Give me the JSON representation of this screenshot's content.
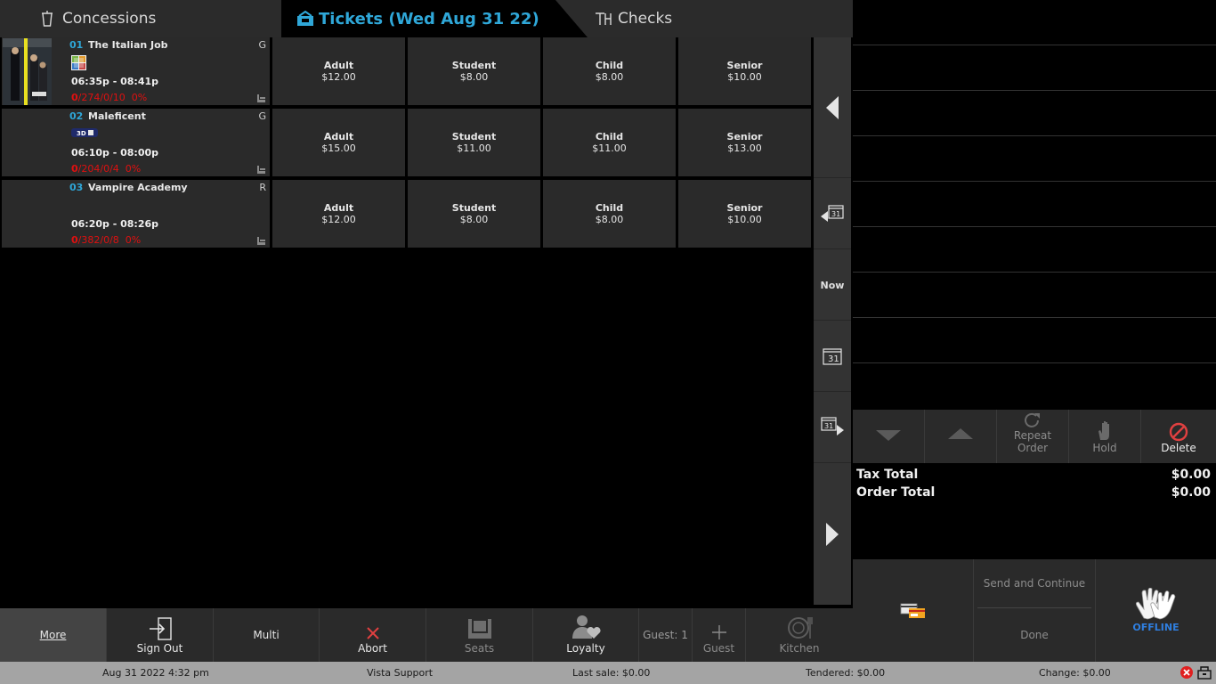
{
  "tabs": {
    "concessions": "Concessions",
    "tickets": "Tickets (Wed Aug 31 22)",
    "checks": "Checks"
  },
  "sessions": [
    {
      "num": "01",
      "title": "The Italian Job",
      "rating": "G",
      "time": "06:35p - 08:41p",
      "stats_sold": "0",
      "stats_rest": "/274/0/10",
      "pct": "0%",
      "prices": [
        {
          "label": "Adult",
          "amount": "$12.00"
        },
        {
          "label": "Student",
          "amount": "$8.00"
        },
        {
          "label": "Child",
          "amount": "$8.00"
        },
        {
          "label": "Senior",
          "amount": "$10.00"
        }
      ]
    },
    {
      "num": "02",
      "title": "Maleficent",
      "rating": "G",
      "time": "06:10p - 08:00p",
      "stats_sold": "0",
      "stats_rest": "/204/0/4",
      "pct": "0%",
      "badge": "3D",
      "prices": [
        {
          "label": "Adult",
          "amount": "$15.00"
        },
        {
          "label": "Student",
          "amount": "$11.00"
        },
        {
          "label": "Child",
          "amount": "$11.00"
        },
        {
          "label": "Senior",
          "amount": "$13.00"
        }
      ]
    },
    {
      "num": "03",
      "title": "Vampire Academy",
      "rating": "R",
      "time": "06:20p - 08:26p",
      "stats_sold": "0",
      "stats_rest": "/382/0/8",
      "pct": "0%",
      "prices": [
        {
          "label": "Adult",
          "amount": "$12.00"
        },
        {
          "label": "Student",
          "amount": "$8.00"
        },
        {
          "label": "Child",
          "amount": "$8.00"
        },
        {
          "label": "Senior",
          "amount": "$10.00"
        }
      ]
    }
  ],
  "nav": {
    "now": "Now",
    "calendar_day": "31"
  },
  "toolbar": {
    "more": "More",
    "sign_out": "Sign Out",
    "multi": "Multi",
    "abort": "Abort",
    "seats": "Seats",
    "loyalty": "Loyalty",
    "guest_count": "Guest: 1",
    "guest": "Guest",
    "kitchen": "Kitchen"
  },
  "order": {
    "repeat_order": "Repeat Order",
    "hold": "Hold",
    "delete": "Delete",
    "tax_total_label": "Tax Total",
    "tax_total_value": "$0.00",
    "order_total_label": "Order Total",
    "order_total_value": "$0.00",
    "send_continue": "Send and Continue",
    "done": "Done",
    "offline": "OFFLINE"
  },
  "status": {
    "datetime": "Aug 31 2022 4:32 pm",
    "user": "Vista Support",
    "last_sale": "Last sale:  $0.00",
    "tendered": "Tendered:  $0.00",
    "change": "Change:  $0.00"
  },
  "colors": {
    "accent": "#2fa7d8",
    "stats_red": "#e01010",
    "delete_red": "#e04040",
    "offline_blue": "#2f7fe0"
  }
}
